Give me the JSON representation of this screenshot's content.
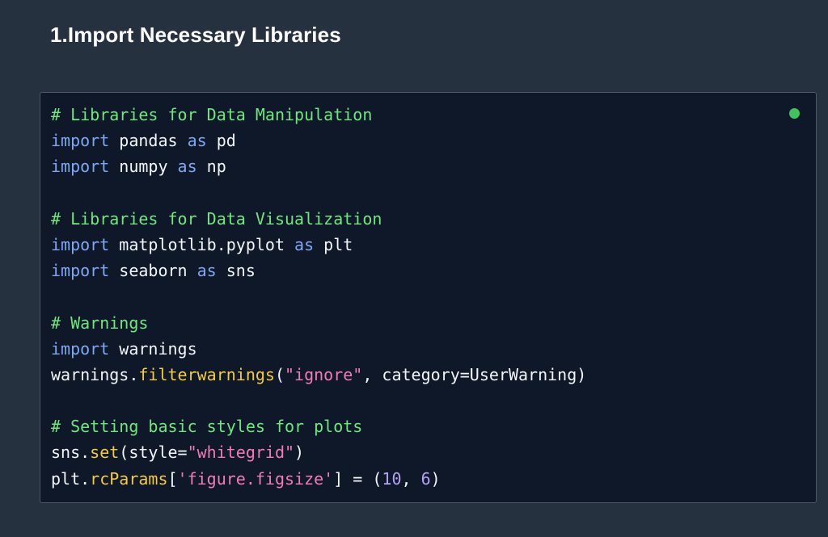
{
  "section": {
    "title": "1.Import Necessary Libraries"
  },
  "code_block": {
    "status_indicator_color": "#3fc45b",
    "colors": {
      "background": "#0e1829",
      "comment": "#6ee87c",
      "keyword": "#7ea9f2",
      "function": "#f4cc3f",
      "string": "#f27ab9",
      "number": "#b4a2f4",
      "plain": "#f4f6fa"
    },
    "lines": [
      [
        {
          "t": "comment",
          "v": "# Libraries for Data Manipulation"
        }
      ],
      [
        {
          "t": "keyword",
          "v": "import"
        },
        {
          "t": "plain",
          "v": " pandas "
        },
        {
          "t": "keyword",
          "v": "as"
        },
        {
          "t": "plain",
          "v": " pd"
        }
      ],
      [
        {
          "t": "keyword",
          "v": "import"
        },
        {
          "t": "plain",
          "v": " numpy "
        },
        {
          "t": "keyword",
          "v": "as"
        },
        {
          "t": "plain",
          "v": " np"
        }
      ],
      [],
      [
        {
          "t": "comment",
          "v": "# Libraries for Data Visualization"
        }
      ],
      [
        {
          "t": "keyword",
          "v": "import"
        },
        {
          "t": "plain",
          "v": " matplotlib.pyplot "
        },
        {
          "t": "keyword",
          "v": "as"
        },
        {
          "t": "plain",
          "v": " plt"
        }
      ],
      [
        {
          "t": "keyword",
          "v": "import"
        },
        {
          "t": "plain",
          "v": " seaborn "
        },
        {
          "t": "keyword",
          "v": "as"
        },
        {
          "t": "plain",
          "v": " sns"
        }
      ],
      [],
      [
        {
          "t": "comment",
          "v": "# Warnings"
        }
      ],
      [
        {
          "t": "keyword",
          "v": "import"
        },
        {
          "t": "plain",
          "v": " warnings"
        }
      ],
      [
        {
          "t": "plain",
          "v": "warnings."
        },
        {
          "t": "func",
          "v": "filterwarnings"
        },
        {
          "t": "plain",
          "v": "("
        },
        {
          "t": "string",
          "v": "\"ignore\""
        },
        {
          "t": "plain",
          "v": ", category=UserWarning)"
        }
      ],
      [],
      [
        {
          "t": "comment",
          "v": "# Setting basic styles for plots"
        }
      ],
      [
        {
          "t": "plain",
          "v": "sns."
        },
        {
          "t": "func",
          "v": "set"
        },
        {
          "t": "plain",
          "v": "(style="
        },
        {
          "t": "string",
          "v": "\"whitegrid\""
        },
        {
          "t": "plain",
          "v": ")"
        }
      ],
      [
        {
          "t": "plain",
          "v": "plt."
        },
        {
          "t": "func",
          "v": "rcParams"
        },
        {
          "t": "plain",
          "v": "["
        },
        {
          "t": "string",
          "v": "'figure.figsize'"
        },
        {
          "t": "plain",
          "v": "] = ("
        },
        {
          "t": "number",
          "v": "10"
        },
        {
          "t": "plain",
          "v": ", "
        },
        {
          "t": "number",
          "v": "6"
        },
        {
          "t": "plain",
          "v": ")"
        }
      ]
    ]
  }
}
